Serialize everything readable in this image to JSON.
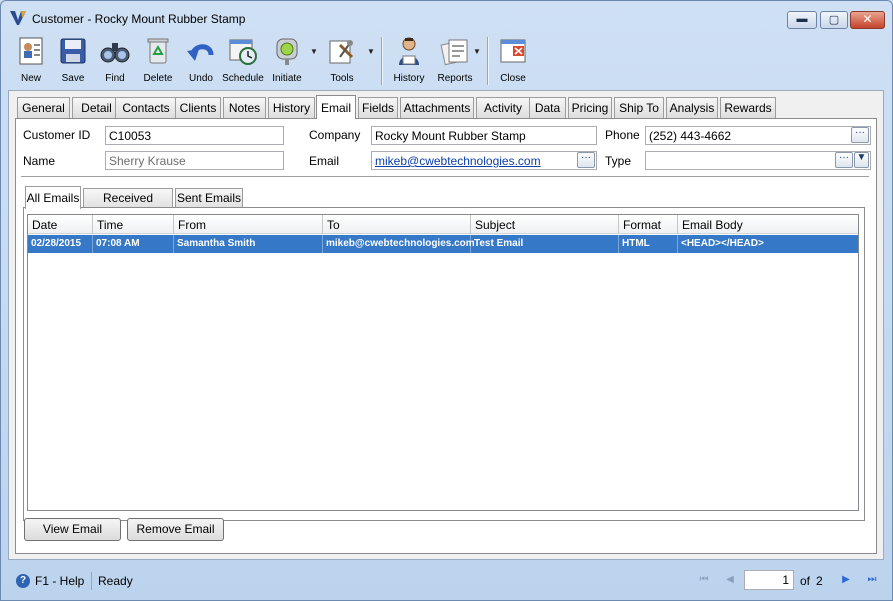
{
  "window": {
    "title": "Customer - Rocky Mount Rubber Stamp",
    "buttons": {
      "minimize": "▬",
      "maximize": "▢",
      "close": "✕"
    }
  },
  "toolbar": {
    "new": "New",
    "save": "Save",
    "find": "Find",
    "delete": "Delete",
    "undo": "Undo",
    "schedule": "Schedule",
    "initiate": "Initiate",
    "tools": "Tools",
    "history": "History",
    "reports": "Reports",
    "close": "Close"
  },
  "tabs": [
    "General",
    "Detail",
    "Contacts",
    "Clients",
    "Notes",
    "History",
    "Email",
    "Fields",
    "Attachments",
    "Activity",
    "Data",
    "Pricing",
    "Ship To",
    "Analysis",
    "Rewards"
  ],
  "active_tab": "Email",
  "form": {
    "customer_id_label": "Customer ID",
    "customer_id": "C10053",
    "name_label": "Name",
    "name": "Sherry Krause",
    "company_label": "Company",
    "company": "Rocky Mount Rubber Stamp",
    "email_label": "Email",
    "email": "mikeb@cwebtechnologies.com",
    "phone_label": "Phone",
    "phone": "(252) 443-4662",
    "type_label": "Type",
    "type": "",
    "ellipsis": "···"
  },
  "subtabs": [
    "All Emails",
    "Received Emails",
    "Sent Emails"
  ],
  "grid": {
    "columns": [
      "Date",
      "Time",
      "From",
      "To",
      "Subject",
      "Format",
      "Email Body"
    ],
    "rows": [
      {
        "date": "02/28/2015",
        "time": "07:08  AM",
        "from": "Samantha Smith",
        "to": "mikeb@cwebtechnologies.com",
        "subject": "Test  Email",
        "format": "HTML",
        "body": "<HEAD></HEAD>"
      }
    ]
  },
  "actions": {
    "view": "View Email",
    "remove": "Remove Email"
  },
  "status": {
    "help": "F1 - Help",
    "state": "Ready",
    "page": "1",
    "of_label": "of",
    "total_pages": "2"
  },
  "colors": {
    "selection": "#3478c7",
    "link": "#0b3ea8",
    "frame": "#c9dcf1"
  }
}
